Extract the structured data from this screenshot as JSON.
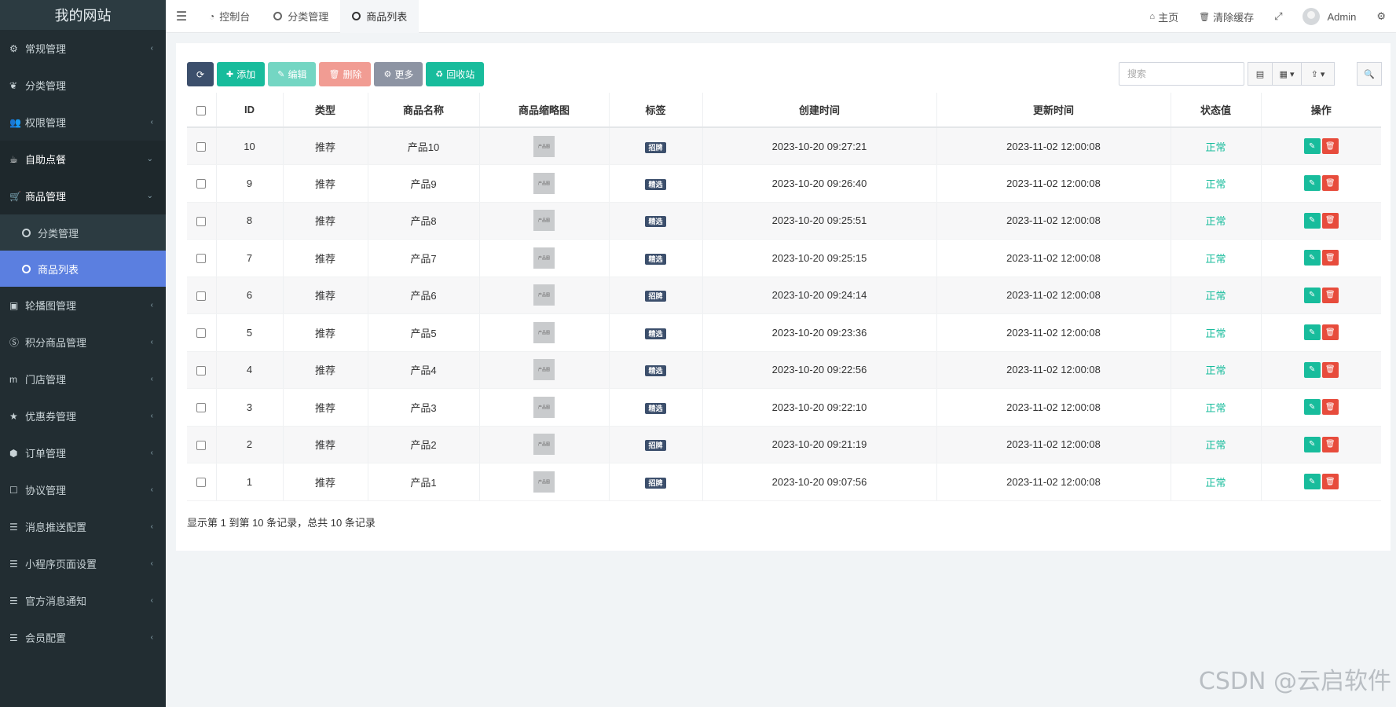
{
  "sidebar": {
    "logo": "我的网站",
    "items_top": [
      {
        "label": "常规管理",
        "icon": "cogs-icon",
        "glyph": "⚙"
      },
      {
        "label": "分类管理",
        "icon": "leaf-icon",
        "glyph": "❦"
      },
      {
        "label": "权限管理",
        "icon": "group-icon",
        "glyph": "👥"
      },
      {
        "label": "自助点餐",
        "icon": "coffee-icon",
        "glyph": "☕"
      },
      {
        "label": "商品管理",
        "icon": "cart-icon",
        "glyph": "🛒"
      }
    ],
    "sub_items": [
      {
        "label": "分类管理"
      },
      {
        "label": "商品列表"
      }
    ],
    "items_bottom": [
      {
        "label": "轮播图管理",
        "icon": "image-icon",
        "glyph": "▣"
      },
      {
        "label": "积分商品管理",
        "icon": "skype-icon",
        "glyph": "Ⓢ"
      },
      {
        "label": "门店管理",
        "icon": "store-icon",
        "glyph": "m"
      },
      {
        "label": "优惠券管理",
        "icon": "star-icon",
        "glyph": "★"
      },
      {
        "label": "订单管理",
        "icon": "cube-icon",
        "glyph": "⬢"
      },
      {
        "label": "协议管理",
        "icon": "edit-icon",
        "glyph": "☐"
      },
      {
        "label": "消息推送配置",
        "icon": "list-icon",
        "glyph": "☰"
      },
      {
        "label": "小程序页面设置",
        "icon": "list-icon",
        "glyph": "☰"
      },
      {
        "label": "官方消息通知",
        "icon": "list-icon",
        "glyph": "☰"
      },
      {
        "label": "会员配置",
        "icon": "list-icon",
        "glyph": "☰"
      }
    ]
  },
  "topbar": {
    "tabs": [
      {
        "label": "控制台",
        "icon": "dashboard-icon"
      },
      {
        "label": "分类管理",
        "icon": "circle-icon"
      },
      {
        "label": "商品列表",
        "icon": "circle-icon"
      }
    ],
    "home": "主页",
    "clear_cache": "清除缓存",
    "user": "Admin"
  },
  "toolbar": {
    "add": "添加",
    "edit": "编辑",
    "delete": "删除",
    "more": "更多",
    "recycle": "回收站",
    "search_placeholder": "搜索"
  },
  "table": {
    "headers": [
      "ID",
      "类型",
      "商品名称",
      "商品缩略图",
      "标签",
      "创建时间",
      "更新时间",
      "状态值",
      "操作"
    ],
    "thumb_text": "产品图",
    "rows": [
      {
        "id": "10",
        "type": "推荐",
        "name": "产品10",
        "tag": "招牌",
        "created": "2023-10-20 09:27:21",
        "updated": "2023-11-02 12:00:08",
        "status": "正常"
      },
      {
        "id": "9",
        "type": "推荐",
        "name": "产品9",
        "tag": "精选",
        "created": "2023-10-20 09:26:40",
        "updated": "2023-11-02 12:00:08",
        "status": "正常"
      },
      {
        "id": "8",
        "type": "推荐",
        "name": "产品8",
        "tag": "精选",
        "created": "2023-10-20 09:25:51",
        "updated": "2023-11-02 12:00:08",
        "status": "正常"
      },
      {
        "id": "7",
        "type": "推荐",
        "name": "产品7",
        "tag": "精选",
        "created": "2023-10-20 09:25:15",
        "updated": "2023-11-02 12:00:08",
        "status": "正常"
      },
      {
        "id": "6",
        "type": "推荐",
        "name": "产品6",
        "tag": "招牌",
        "created": "2023-10-20 09:24:14",
        "updated": "2023-11-02 12:00:08",
        "status": "正常"
      },
      {
        "id": "5",
        "type": "推荐",
        "name": "产品5",
        "tag": "精选",
        "created": "2023-10-20 09:23:36",
        "updated": "2023-11-02 12:00:08",
        "status": "正常"
      },
      {
        "id": "4",
        "type": "推荐",
        "name": "产品4",
        "tag": "精选",
        "created": "2023-10-20 09:22:56",
        "updated": "2023-11-02 12:00:08",
        "status": "正常"
      },
      {
        "id": "3",
        "type": "推荐",
        "name": "产品3",
        "tag": "精选",
        "created": "2023-10-20 09:22:10",
        "updated": "2023-11-02 12:00:08",
        "status": "正常"
      },
      {
        "id": "2",
        "type": "推荐",
        "name": "产品2",
        "tag": "招牌",
        "created": "2023-10-20 09:21:19",
        "updated": "2023-11-02 12:00:08",
        "status": "正常"
      },
      {
        "id": "1",
        "type": "推荐",
        "name": "产品1",
        "tag": "招牌",
        "created": "2023-10-20 09:07:56",
        "updated": "2023-11-02 12:00:08",
        "status": "正常"
      }
    ]
  },
  "pagination_info": "显示第 1 到第 10 条记录，总共 10 条记录",
  "watermark": "CSDN @云启软件",
  "colors": {
    "sidebar_bg": "#222d32",
    "active_item": "#5b7fe0",
    "success": "#18bc9c",
    "danger": "#e74c3c",
    "primary_dark": "#3c4f6c"
  }
}
